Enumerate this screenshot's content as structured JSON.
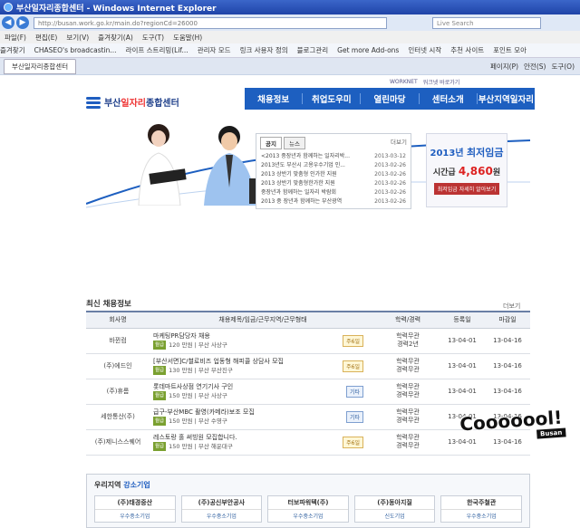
{
  "window": {
    "title": "부산일자리종합센터 - Windows Internet Explorer"
  },
  "address": {
    "url": "http://busan.work.go.kr/main.do?regionCd=26000",
    "search_placeholder": "Live Search"
  },
  "menubar": [
    "파일(F)",
    "편집(E)",
    "보기(V)",
    "즐겨찾기(A)",
    "도구(T)",
    "도움말(H)"
  ],
  "favbar": [
    "즐겨찾기",
    "CHASEO's broadcastin...",
    "라이프 스트리밍(Lif...",
    "관리자 모드",
    "링크 사용자 정의",
    "블로그관리",
    "Get more Add-ons",
    "인터넷 시작",
    "추천 사이트",
    "포인트 모아"
  ],
  "tab": {
    "label": "부산일자리종합센터"
  },
  "tools": [
    "페이지(P)",
    "안전(S)",
    "도구(O)"
  ],
  "site": {
    "logo_pre": "부산",
    "logo_hl": "일자리",
    "logo_post": "종합센터",
    "top_links": [
      "WORKNET",
      "워크넷 바로가기"
    ],
    "nav": [
      "채용정보",
      "취업도우미",
      "열린마당",
      "센터소개",
      "부산지역일자리"
    ]
  },
  "news": {
    "tabs": [
      "공지",
      "뉴스"
    ],
    "more": "더보기",
    "items": [
      {
        "title": "<2013 중장년과 함께하는 일자리박...",
        "date": "2013-03-12"
      },
      {
        "title": "2013년도 부산시 고용우수기업 인...",
        "date": "2013-02-26"
      },
      {
        "title": "2013 상반기 맞춤형 인가한 지원",
        "date": "2013-02-26"
      },
      {
        "title": "2013 상반기 맞춤형한가한 지원",
        "date": "2013-02-26"
      },
      {
        "title": "중장년과 함께하는 일자리 박람회",
        "date": "2013-02-26"
      },
      {
        "title": "2013 중 장년과 함께하는 부산광역",
        "date": "2013-02-26"
      }
    ]
  },
  "wage": {
    "year": "2013년",
    "label": "최저임금",
    "hour_label": "시간급",
    "amount": "4,860",
    "unit": "원",
    "button": "최저임금 자세히 알아보기"
  },
  "jobs": {
    "title": "최신 채용정보",
    "more": "더보기",
    "headers": [
      "회사명",
      "채용제목/임금/근무지역/근무형태",
      "학력/경력",
      "등록일",
      "마감일"
    ],
    "rows": [
      {
        "company": "바뀐컴",
        "title": "마케팅PR담당자 채용",
        "pay_tag": "월급",
        "pay": "120 만원 | 부산 사상구",
        "type": "주6일",
        "edu": "학력무관",
        "career": "경력2년",
        "reg": "13-04-01",
        "end": "13-04-16",
        "etc": false
      },
      {
        "company": "(주)에드인",
        "title": "[부산서면]C/쳘로비즈 업동형 해피콜 상담사 모집",
        "pay_tag": "월급",
        "pay": "130 만원 | 부산 부산진구",
        "type": "주6일",
        "edu": "학력무관",
        "career": "경력무관",
        "reg": "13-04-01",
        "end": "13-04-16",
        "etc": false
      },
      {
        "company": "(주)휴롬",
        "title": "롯데마트사상점 연기기사 구인",
        "pay_tag": "월급",
        "pay": "150 만원 | 부산 사상구",
        "type": "기타",
        "edu": "학력무관",
        "career": "경력무관",
        "reg": "13-04-01",
        "end": "13-04-16",
        "etc": true
      },
      {
        "company": "세한통산(주)",
        "title": "급구-부산MBC 촬영(카메라)보조 모집",
        "pay_tag": "월급",
        "pay": "150 만원 | 부산 수영구",
        "type": "기타",
        "edu": "학력무관",
        "career": "경력무관",
        "reg": "13-04-01",
        "end": "13-04-16",
        "etc": true
      },
      {
        "company": "(주)제니스스퀘어",
        "title": "레스토랑 홀 써빙원 모집합니다.",
        "pay_tag": "월급",
        "pay": "150 만원 | 부산 해운대구",
        "type": "주6일",
        "edu": "학력무관",
        "career": "경력무관",
        "reg": "13-04-01",
        "end": "13-04-16",
        "etc": false
      }
    ]
  },
  "small": {
    "title_pre": "우리지역 ",
    "title_hl": "강소기업",
    "cards": [
      {
        "name": "(주)태경중산",
        "sub": "우수중소기업"
      },
      {
        "name": "(주)공신부안공사",
        "sub": "우수중소기업"
      },
      {
        "name": "터보파워텍(주)",
        "sub": "우수중소기업"
      },
      {
        "name": "(주)동아지질",
        "sub": "신도기업"
      },
      {
        "name": "한국주철관",
        "sub": "우수중소기업"
      }
    ]
  },
  "brand": {
    "text": "Cooooool!",
    "tag": "Busan"
  },
  "colors": {
    "nav": "#1d5fc0",
    "title_bar": "#1f44a8",
    "wage_amount": "#dd2222"
  }
}
